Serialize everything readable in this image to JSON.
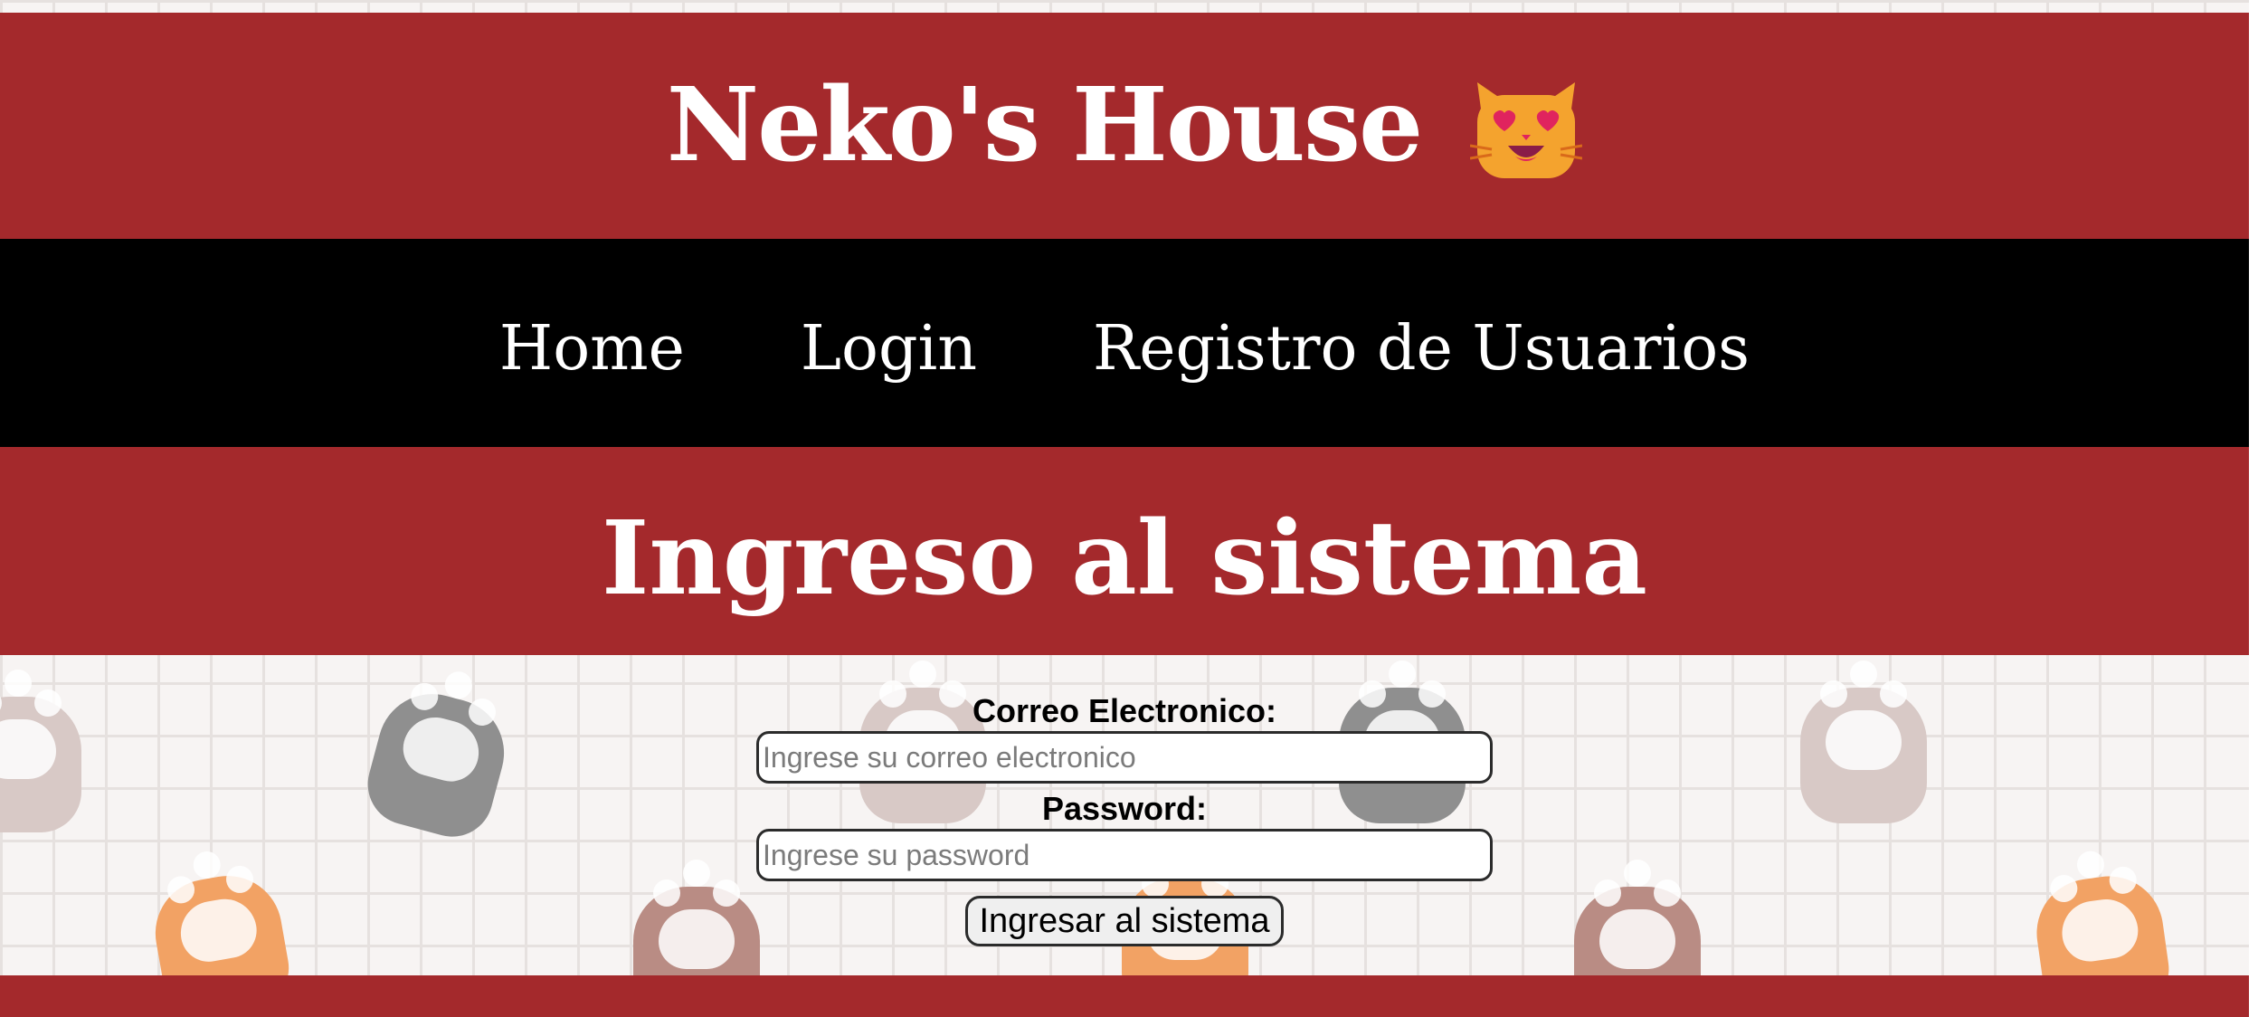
{
  "header": {
    "site_title": "Neko's House",
    "emoji_icon": "smiling-cat-heart-eyes-icon"
  },
  "nav": {
    "items": [
      {
        "label": "Home"
      },
      {
        "label": "Login"
      },
      {
        "label": "Registro de Usuarios"
      }
    ]
  },
  "page": {
    "title": "Ingreso al sistema"
  },
  "form": {
    "email_label": "Correo Electronico:",
    "email_placeholder": "Ingrese su correo electronico",
    "password_label": "Password:",
    "password_placeholder": "Ingrese su password",
    "submit_label": "Ingresar al sistema"
  },
  "colors": {
    "brand_red": "#a4292c",
    "nav_black": "#000000"
  }
}
